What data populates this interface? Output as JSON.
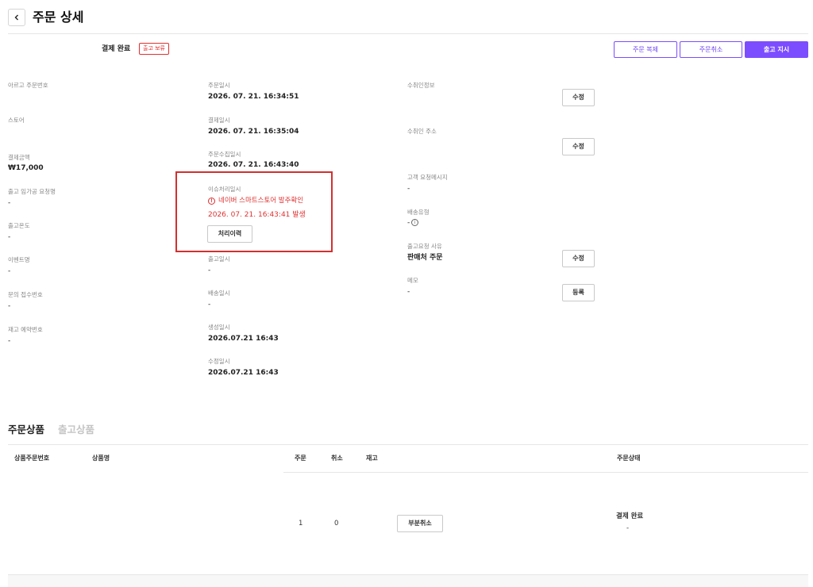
{
  "header": {
    "title": "주문 상세"
  },
  "status": {
    "label": "결제 완료",
    "badge": "출고 보류"
  },
  "actions": {
    "copy_order": "주문 복제",
    "cancel_order": "주문취소",
    "ship_order": "출고 지시"
  },
  "col1": [
    {
      "label": "아르고 주문번호",
      "value": ""
    },
    {
      "label": "스토어",
      "value": ""
    },
    {
      "label": "결제금액",
      "value": "₩17,000"
    },
    {
      "label": "출고 임가공 요청명",
      "value": "-"
    },
    {
      "label": "출고온도",
      "value": "-"
    },
    {
      "label": "이벤트명",
      "value": "-"
    },
    {
      "label": "문의 접수번호",
      "value": "-"
    },
    {
      "label": "재고 예약번호",
      "value": "-"
    }
  ],
  "col2": [
    {
      "label": "주문일시",
      "value": "2026. 07. 21. 16:34:51"
    },
    {
      "label": "결제일시",
      "value": "2026. 07. 21. 16:35:04"
    },
    {
      "label": "주문수집일시",
      "value": "2026. 07. 21. 16:43:40"
    },
    {
      "label": "출고일시",
      "value": "-"
    },
    {
      "label": "배송일시",
      "value": "-"
    },
    {
      "label": "생성일시",
      "value": "2026.07.21 16:43"
    },
    {
      "label": "수정일시",
      "value": "2026.07.21 16:43"
    }
  ],
  "issue": {
    "label": "이슈처리일시",
    "icon": "!",
    "message": "네이버 스마트스토어 발주확인",
    "date": "2026. 07. 21. 16:43:41 발생",
    "history_button": "처리이력"
  },
  "col3": {
    "receiver_info": {
      "label": "수취인정보",
      "button": "수정"
    },
    "receiver_address": {
      "label": "수취인 주소",
      "button": "수정"
    },
    "customer_message": {
      "label": "고객 요청메시지",
      "value": "-"
    },
    "delivery_type": {
      "label": "배송유형",
      "value": "-",
      "icon": "i"
    },
    "ship_request": {
      "label": "출고요청 사유",
      "value": "판매처 주문",
      "button": "수정"
    },
    "memo": {
      "label": "메모",
      "value": "-",
      "button": "등록"
    }
  },
  "tabs": {
    "order_items": "주문상품",
    "ship_items": "출고상품"
  },
  "table": {
    "headers": {
      "item_no": "상품주문번호",
      "name": "상품명",
      "order": "주문",
      "cancel": "취소",
      "stock": "재고",
      "status": "주문상태"
    },
    "row": {
      "order": "1",
      "cancel": "0",
      "partial_cancel": "부분취소",
      "status": "결제 완료",
      "status_sub": "-"
    }
  },
  "colors": {
    "accent": "#7c4dff",
    "alert": "#e03131"
  }
}
